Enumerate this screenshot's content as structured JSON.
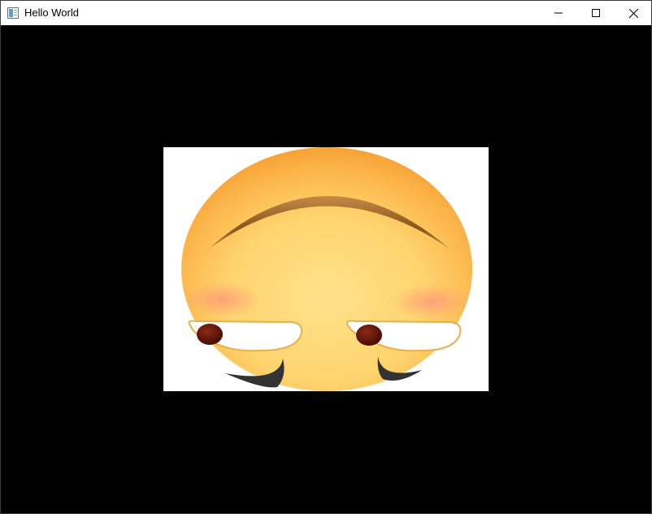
{
  "window": {
    "title": "Hello World",
    "icon": "window-app-icon",
    "controls": {
      "minimize_icon": "minimize-icon",
      "maximize_icon": "maximize-icon",
      "close_icon": "close-icon"
    }
  },
  "content": {
    "background": "#000000",
    "image": {
      "subject": "upside-down-blushing-emoji",
      "colors": {
        "face_light": "#FFE08A",
        "face_dark": "#F8A838",
        "blush": "#FF9C7A",
        "eyebrow": "#8B5A1E",
        "pupil": "#5A1208",
        "stroke": "#333333"
      }
    }
  }
}
